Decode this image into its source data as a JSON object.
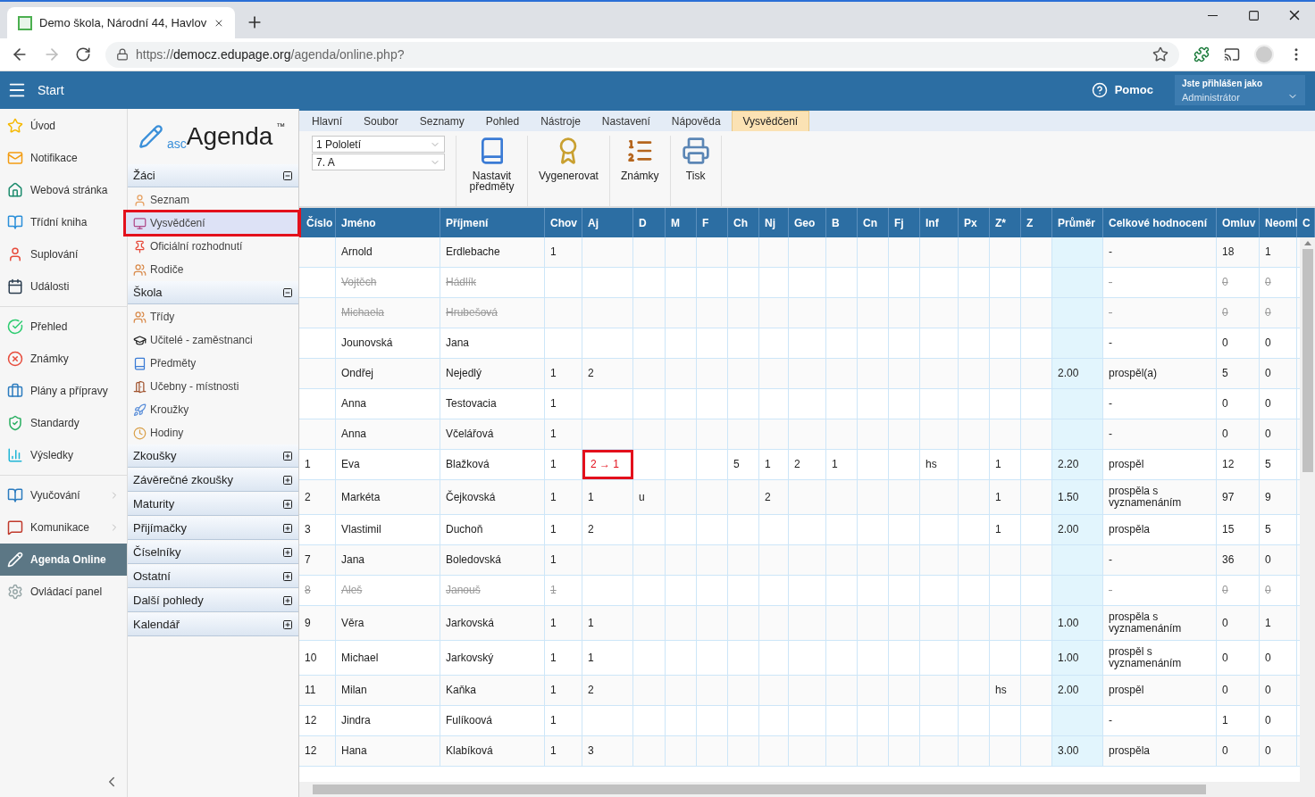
{
  "browser": {
    "tab_title": "Demo škola, Národní 44, Havlov",
    "url_scheme": "https://",
    "url_host": "democz.edupage.org",
    "url_path": "/agenda/online.php?",
    "forward_disabled": true
  },
  "app_header": {
    "menu_label": "Start",
    "help_label": "Pomoc",
    "user_caption": "Jste přihlášen jako",
    "user_role": "Administrátor"
  },
  "nav_groups": [
    {
      "items": [
        {
          "label": "Úvod",
          "selected": false,
          "has_submenu": false
        },
        {
          "label": "Notifikace",
          "selected": false,
          "has_submenu": false
        },
        {
          "label": "Webová stránka",
          "selected": false,
          "has_submenu": false
        },
        {
          "label": "Třídní kniha",
          "selected": false,
          "has_submenu": false
        },
        {
          "label": "Suplování",
          "selected": false,
          "has_submenu": false
        },
        {
          "label": "Události",
          "selected": false,
          "has_submenu": false
        }
      ]
    },
    {
      "items": [
        {
          "label": "Přehled",
          "selected": false,
          "has_submenu": false
        },
        {
          "label": "Známky",
          "selected": false,
          "has_submenu": false
        },
        {
          "label": "Plány a přípravy",
          "selected": false,
          "has_submenu": false
        },
        {
          "label": "Standardy",
          "selected": false,
          "has_submenu": false
        },
        {
          "label": "Výsledky",
          "selected": false,
          "has_submenu": false
        }
      ]
    },
    {
      "items": [
        {
          "label": "Vyučování",
          "selected": false,
          "has_submenu": true
        },
        {
          "label": "Komunikace",
          "selected": false,
          "has_submenu": true
        },
        {
          "label": "Agenda Online",
          "selected": true,
          "has_submenu": false
        },
        {
          "label": "Ovládací panel",
          "selected": false,
          "has_submenu": false
        }
      ]
    }
  ],
  "agenda": {
    "logo_prefix": "asc",
    "logo_name": "Agenda",
    "logo_mark": "™",
    "sections": [
      {
        "title": "Žáci",
        "expanded": true,
        "items": [
          {
            "label": "Seznam",
            "selected": false
          },
          {
            "label": "Vysvědčení",
            "selected": true
          },
          {
            "label": "Oficiální rozhodnutí",
            "selected": false
          },
          {
            "label": "Rodiče",
            "selected": false
          }
        ]
      },
      {
        "title": "Škola",
        "expanded": true,
        "items": [
          {
            "label": "Třídy",
            "selected": false
          },
          {
            "label": "Učitelé - zaměstnanci",
            "selected": false
          },
          {
            "label": "Předměty",
            "selected": false
          },
          {
            "label": "Učebny - místnosti",
            "selected": false
          },
          {
            "label": "Kroužky",
            "selected": false
          },
          {
            "label": "Hodiny",
            "selected": false
          }
        ]
      },
      {
        "title": "Zkoušky",
        "expanded": false
      },
      {
        "title": "Závěrečné zkoušky",
        "expanded": false
      },
      {
        "title": "Maturity",
        "expanded": false
      },
      {
        "title": "Přijímačky",
        "expanded": false
      },
      {
        "title": "Číselníky",
        "expanded": false
      },
      {
        "title": "Ostatní",
        "expanded": false
      },
      {
        "title": "Další pohledy",
        "expanded": false
      },
      {
        "title": "Kalendář",
        "expanded": false
      }
    ]
  },
  "ribbon": {
    "tabs": [
      {
        "label": "Hlavní",
        "selected": false
      },
      {
        "label": "Soubor",
        "selected": false
      },
      {
        "label": "Seznamy",
        "selected": false
      },
      {
        "label": "Pohled",
        "selected": false
      },
      {
        "label": "Nástroje",
        "selected": false
      },
      {
        "label": "Nastavení",
        "selected": false
      },
      {
        "label": "Nápověda",
        "selected": false
      },
      {
        "label": "Vysvědčení",
        "selected": true
      }
    ],
    "selects": [
      {
        "value": "1 Pololetí"
      },
      {
        "value": "7. A"
      }
    ],
    "buttons": [
      {
        "label": "Nastavit předměty"
      },
      {
        "label": "Vygenerovat"
      },
      {
        "label": "Známky"
      },
      {
        "label": "Tisk"
      }
    ]
  },
  "table": {
    "columns": [
      "Číslo",
      "Jméno",
      "Příjmení",
      "Chov",
      "Aj",
      "D",
      "M",
      "F",
      "Ch",
      "Nj",
      "Geo",
      "B",
      "Cn",
      "Fj",
      "Inf",
      "Px",
      "Z*",
      "Z",
      "Průměr",
      "Celkové hodnocení",
      "Omluv",
      "Neoml",
      "C"
    ],
    "rows": [
      {
        "withdrawn": false,
        "cells": [
          null,
          "Arnold",
          "Erdlebache",
          "1",
          null,
          null,
          null,
          null,
          null,
          null,
          null,
          null,
          null,
          null,
          null,
          null,
          null,
          null,
          null,
          "-",
          "18",
          "1"
        ]
      },
      {
        "withdrawn": true,
        "cells": [
          null,
          "Vojtěch",
          "Hádlík",
          null,
          null,
          null,
          null,
          null,
          null,
          null,
          null,
          null,
          null,
          null,
          null,
          null,
          null,
          null,
          null,
          "-",
          "0",
          "0"
        ]
      },
      {
        "withdrawn": true,
        "cells": [
          null,
          "Michaela",
          "Hrubešová",
          null,
          null,
          null,
          null,
          null,
          null,
          null,
          null,
          null,
          null,
          null,
          null,
          null,
          null,
          null,
          null,
          "-",
          "0",
          "0"
        ]
      },
      {
        "withdrawn": false,
        "cells": [
          null,
          "Jounovská",
          "Jana",
          null,
          null,
          null,
          null,
          null,
          null,
          null,
          null,
          null,
          null,
          null,
          null,
          null,
          null,
          null,
          null,
          "-",
          "0",
          "0"
        ]
      },
      {
        "withdrawn": false,
        "cells": [
          null,
          "Ondřej",
          "Nejedlý",
          "1",
          "2",
          null,
          null,
          null,
          null,
          null,
          null,
          null,
          null,
          null,
          null,
          null,
          null,
          null,
          "2.00",
          "prospěl(a)",
          "5",
          "0"
        ]
      },
      {
        "withdrawn": false,
        "cells": [
          null,
          "Anna",
          "Testovacia",
          "1",
          null,
          null,
          null,
          null,
          null,
          null,
          null,
          null,
          null,
          null,
          null,
          null,
          null,
          null,
          null,
          "-",
          "0",
          "0"
        ]
      },
      {
        "withdrawn": false,
        "cells": [
          null,
          "Anna",
          "Včelářová",
          "1",
          null,
          null,
          null,
          null,
          null,
          null,
          null,
          null,
          null,
          null,
          null,
          null,
          null,
          null,
          null,
          "-",
          "0",
          "0"
        ]
      },
      {
        "withdrawn": false,
        "cells": [
          "1",
          "Eva",
          "Blažková",
          "1",
          {
            "text": "2 → 1",
            "highlighted": true
          },
          null,
          null,
          null,
          "5",
          "1",
          "2",
          "1",
          null,
          null,
          "hs",
          null,
          "1",
          null,
          "2.20",
          "prospěl",
          "12",
          "5"
        ]
      },
      {
        "withdrawn": false,
        "cells": [
          "2",
          "Markéta",
          "Čejkovská",
          "1",
          "1",
          "u",
          null,
          null,
          null,
          "2",
          null,
          null,
          null,
          null,
          null,
          null,
          "1",
          null,
          "1.50",
          "prospěla s vyznamenáním",
          "97",
          "9"
        ]
      },
      {
        "withdrawn": false,
        "cells": [
          "3",
          "Vlastimil",
          "Duchoň",
          "1",
          "2",
          null,
          null,
          null,
          null,
          null,
          null,
          null,
          null,
          null,
          null,
          null,
          "1",
          null,
          "2.00",
          "prospěla",
          "15",
          "5"
        ]
      },
      {
        "withdrawn": false,
        "cells": [
          "7",
          "Jana",
          "Boledovská",
          "1",
          null,
          null,
          null,
          null,
          null,
          null,
          null,
          null,
          null,
          null,
          null,
          null,
          null,
          null,
          null,
          "-",
          "36",
          "0"
        ]
      },
      {
        "withdrawn": true,
        "cells": [
          "8",
          "Aleš",
          "Janouš",
          "1",
          null,
          null,
          null,
          null,
          null,
          null,
          null,
          null,
          null,
          null,
          null,
          null,
          null,
          null,
          null,
          "-",
          "0",
          "0"
        ]
      },
      {
        "withdrawn": false,
        "cells": [
          "9",
          "Věra",
          "Jarkovská",
          "1",
          "1",
          null,
          null,
          null,
          null,
          null,
          null,
          null,
          null,
          null,
          null,
          null,
          null,
          null,
          "1.00",
          "prospěla s vyznamenáním",
          "0",
          "1"
        ]
      },
      {
        "withdrawn": false,
        "cells": [
          "10",
          "Michael",
          "Jarkovský",
          "1",
          "1",
          null,
          null,
          null,
          null,
          null,
          null,
          null,
          null,
          null,
          null,
          null,
          null,
          null,
          "1.00",
          "prospěl s vyznamenáním",
          "0",
          "0"
        ]
      },
      {
        "withdrawn": false,
        "cells": [
          "11",
          "Milan",
          "Kaňka",
          "1",
          "2",
          null,
          null,
          null,
          null,
          null,
          null,
          null,
          null,
          null,
          null,
          null,
          "hs",
          null,
          "2.00",
          "prospěl",
          "0",
          "0"
        ]
      },
      {
        "withdrawn": false,
        "cells": [
          "12",
          "Jindra",
          "Fulíkoová",
          "1",
          null,
          null,
          null,
          null,
          null,
          null,
          null,
          null,
          null,
          null,
          null,
          null,
          null,
          null,
          null,
          "-",
          "1",
          "0"
        ]
      },
      {
        "withdrawn": false,
        "cells": [
          "12",
          "Hana",
          "Klabíková",
          "1",
          "3",
          null,
          null,
          null,
          null,
          null,
          null,
          null,
          null,
          null,
          null,
          null,
          null,
          null,
          "3.00",
          "prospěla",
          "0",
          "0"
        ]
      }
    ]
  }
}
